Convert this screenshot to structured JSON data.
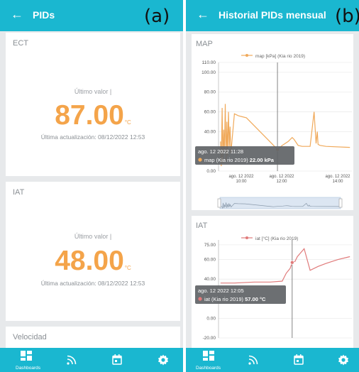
{
  "panel_a": {
    "title": "PIDs",
    "tag": "(a)",
    "cards": [
      {
        "title": "ECT",
        "caption": "Último valor",
        "value": "87.00",
        "unit": "°C",
        "updated": "Última actualización: 08/12/2022 12:53"
      },
      {
        "title": "IAT",
        "caption": "Último valor",
        "value": "48.00",
        "unit": "°C",
        "updated": "Última actualización: 08/12/2022 12:53"
      },
      {
        "title": "Velocidad"
      }
    ]
  },
  "panel_b": {
    "title": "Historial PIDs mensual",
    "tag": "(b)"
  },
  "bottom_nav": {
    "dashboards": "Dashboards"
  },
  "colors": {
    "appbar": "#1ab7d0",
    "value": "#f4a44a",
    "map_series": "#f0a95a",
    "iat_series": "#e07a7a",
    "tooltip_bg": "#5f6366"
  },
  "chart_data": [
    {
      "type": "line",
      "title": "MAP",
      "legend": "map [kPa] (Kia rio 2019)",
      "yticks": [
        "110.00",
        "100.00",
        "80.00",
        "60.00",
        "40.00",
        "0.00"
      ],
      "ylim": [
        0,
        110
      ],
      "xticks": [
        {
          "date": "ago. 12 2022",
          "time": "10:00"
        },
        {
          "date": "ago. 12 2022",
          "time": "12:00"
        },
        {
          "date": "ago. 12 2022",
          "time": "14:00"
        }
      ],
      "x": [
        "09:05",
        "09:07",
        "09:09",
        "09:11",
        "09:13",
        "09:15",
        "09:17",
        "09:19",
        "09:21",
        "09:23",
        "09:25",
        "09:27",
        "09:29",
        "09:31",
        "09:40",
        "09:50",
        "10:00",
        "10:10",
        "11:28",
        "11:40",
        "11:55",
        "12:05",
        "12:10",
        "12:20",
        "12:30",
        "12:50",
        "13:00",
        "13:05",
        "13:08",
        "13:10",
        "13:15",
        "13:30",
        "14:30"
      ],
      "values": [
        30,
        5,
        64,
        8,
        42,
        20,
        68,
        10,
        50,
        15,
        60,
        25,
        45,
        18,
        58,
        56,
        55,
        54,
        22,
        26,
        30,
        34,
        32,
        26,
        25,
        25,
        60,
        28,
        40,
        27,
        26,
        25,
        24
      ],
      "tooltip": {
        "time": "ago. 12 2022 11:28",
        "series": "map (Kia rio 2019)",
        "value": "22.00 kPa"
      }
    },
    {
      "type": "line",
      "title": "IAT",
      "legend": "iat [°C] (Kia rio 2019)",
      "yticks": [
        "75.00",
        "60.00",
        "40.00",
        "0.00",
        "-20.00"
      ],
      "ylim": [
        -20,
        80
      ],
      "x": [
        "09:05",
        "09:40",
        "10:30",
        "11:10",
        "11:40",
        "11:50",
        "12:00",
        "12:05",
        "12:12",
        "12:18",
        "12:35",
        "12:50",
        "13:10",
        "13:30",
        "14:00",
        "14:30"
      ],
      "values": [
        36,
        36,
        37,
        37,
        38,
        46,
        51,
        57,
        58,
        63,
        71,
        49,
        53,
        56,
        60,
        63
      ],
      "tooltip": {
        "time": "ago. 12 2022 12:05",
        "series": "iat (Kia rio 2019)",
        "value": "57.00 °C"
      }
    }
  ]
}
